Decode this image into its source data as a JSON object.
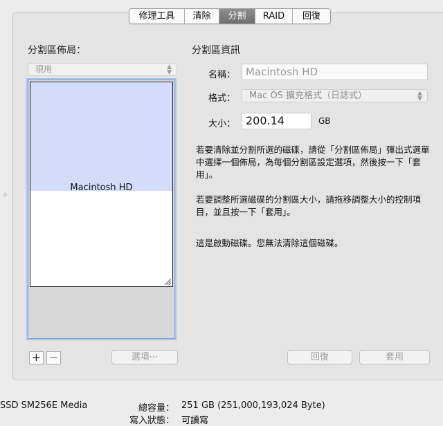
{
  "tabs": [
    {
      "label": "修理工具",
      "active": false
    },
    {
      "label": "清除",
      "active": false
    },
    {
      "label": "分割",
      "active": true
    },
    {
      "label": "RAID",
      "active": false
    },
    {
      "label": "回復",
      "active": false
    }
  ],
  "layout_panel": {
    "heading": "分割區佈局：",
    "popup_value": "現用",
    "partition_name": "Macintosh HD",
    "options_button": "選項⋯",
    "add_label": "+",
    "remove_label": "−"
  },
  "info_panel": {
    "heading": "分割區資訊",
    "name_label": "名稱：",
    "name_value": "Macintosh HD",
    "format_label": "格式：",
    "format_value": "Mac OS 擴充格式（日誌式）",
    "size_label": "大小：",
    "size_value": "200.14",
    "size_unit": "GB",
    "help_1": "若要清除並分割所選的磁碟，請從「分割區佈局」彈出式選單中選擇一個佈局，為每個分割區設定選項，然後按一下「套用」。",
    "help_2": "若要調整所選磁碟的分割區大小，請拖移調整大小的控制項目，並且按一下「套用」。",
    "help_3": "這是啟動磁碟。您無法清除這個磁碟。"
  },
  "buttons": {
    "revert": "回復",
    "apply": "套用"
  },
  "footer": {
    "disk_name": "SSD SM256E Media",
    "capacity_label": "總容量：",
    "capacity_value": "251 GB (251,000,193,024 Byte)",
    "status_label": "寫入狀態：",
    "status_value": "可讀寫"
  }
}
